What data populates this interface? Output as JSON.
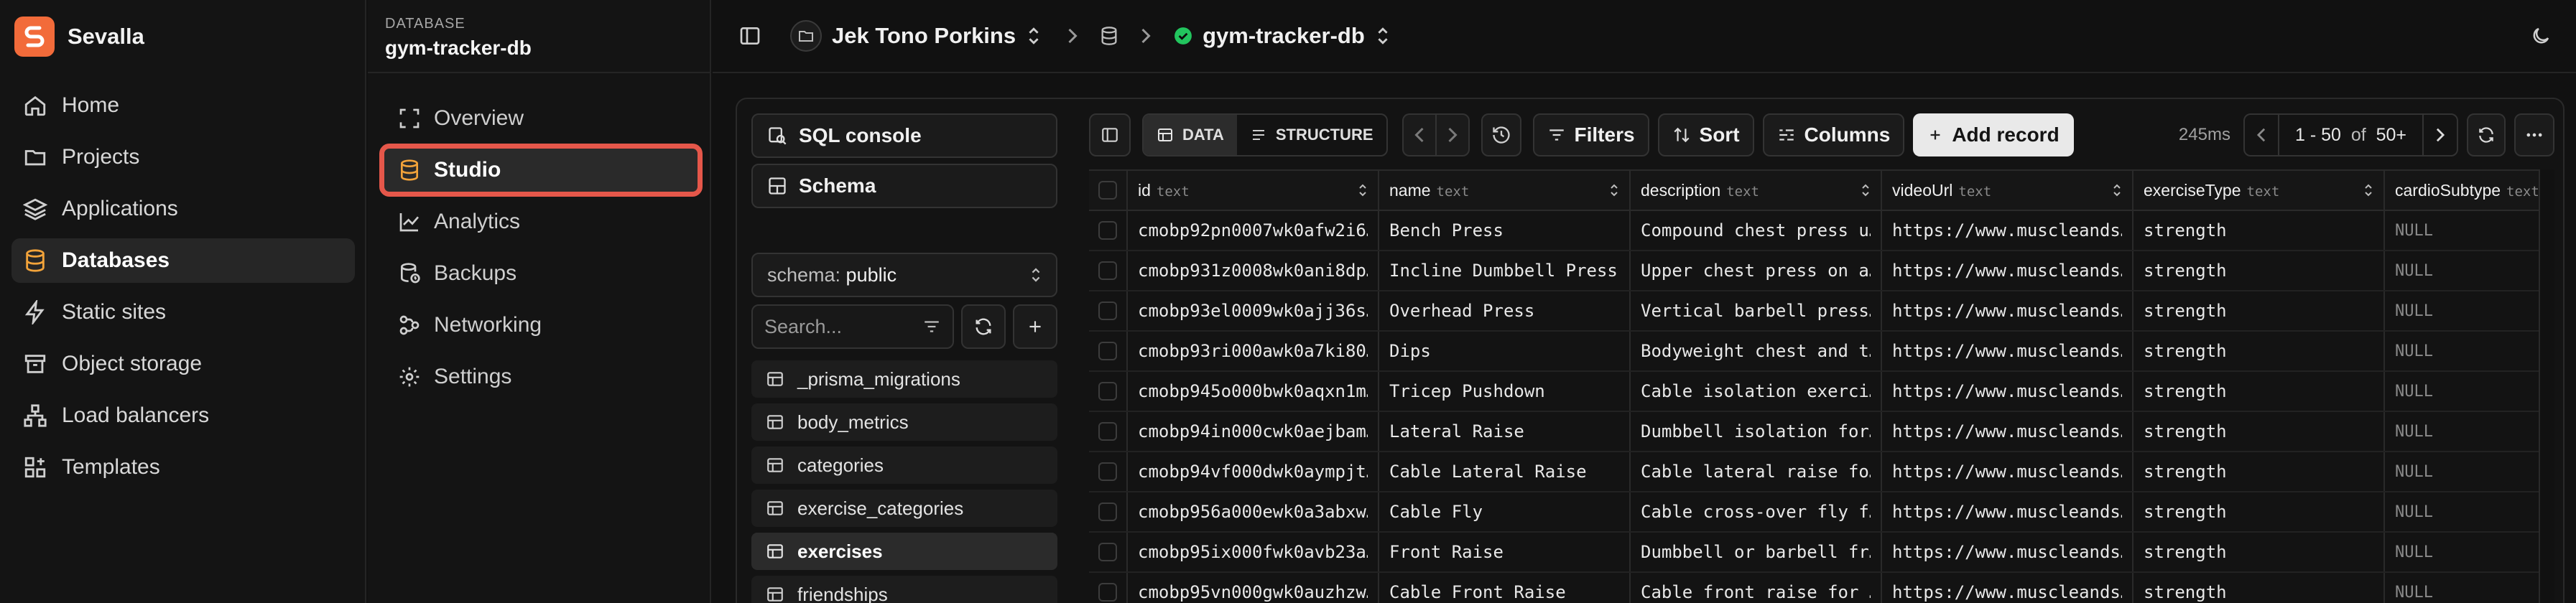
{
  "brand": {
    "name": "Sevalla"
  },
  "sidebar": {
    "items": [
      {
        "label": "Home",
        "icon": "home-icon"
      },
      {
        "label": "Projects",
        "icon": "folder-icon"
      },
      {
        "label": "Applications",
        "icon": "layers-icon"
      },
      {
        "label": "Databases",
        "icon": "database-icon",
        "active": true
      },
      {
        "label": "Static sites",
        "icon": "bolt-icon"
      },
      {
        "label": "Object storage",
        "icon": "archive-icon"
      },
      {
        "label": "Load balancers",
        "icon": "network-icon"
      },
      {
        "label": "Templates",
        "icon": "templates-icon"
      }
    ]
  },
  "db_sidebar": {
    "label": "DATABASE",
    "name": "gym-tracker-db",
    "items": [
      {
        "label": "Overview",
        "icon": "scan-icon"
      },
      {
        "label": "Studio",
        "icon": "database-icon",
        "active": true
      },
      {
        "label": "Analytics",
        "icon": "chart-icon"
      },
      {
        "label": "Backups",
        "icon": "backup-icon"
      },
      {
        "label": "Networking",
        "icon": "networking-icon"
      },
      {
        "label": "Settings",
        "icon": "gear-icon"
      }
    ]
  },
  "topbar": {
    "project": "Jek Tono Porkins",
    "database": "gym-tracker-db",
    "status_color": "#22c55e"
  },
  "studio": {
    "sql_console": "SQL console",
    "schema_btn": "Schema",
    "schema_select_prefix": "schema: ",
    "schema_select_value": "public",
    "search_placeholder": "Search...",
    "tables": [
      "_prisma_migrations",
      "body_metrics",
      "categories",
      "exercise_categories",
      "exercises",
      "friendships"
    ],
    "active_table": "exercises"
  },
  "toolbar": {
    "data_tab": "DATA",
    "structure_tab": "STRUCTURE",
    "filters": "Filters",
    "sort": "Sort",
    "columns": "Columns",
    "add_record": "Add record",
    "timing": "245ms",
    "page_range": "1 - 50",
    "page_of": "of",
    "page_total": "50+"
  },
  "table": {
    "columns": [
      {
        "name": "id",
        "type": "text"
      },
      {
        "name": "name",
        "type": "text"
      },
      {
        "name": "description",
        "type": "text"
      },
      {
        "name": "videoUrl",
        "type": "text"
      },
      {
        "name": "exerciseType",
        "type": "text"
      },
      {
        "name": "cardioSubtype",
        "type": "text"
      }
    ],
    "rows": [
      [
        "cmobp92pn0007wk0afw2i6…",
        "Bench Press",
        "Compound chest press u…",
        "https://www.muscleands…",
        "strength",
        "NULL"
      ],
      [
        "cmobp931z0008wk0ani8dp…",
        "Incline Dumbbell Press",
        "Upper chest press on a…",
        "https://www.muscleands…",
        "strength",
        "NULL"
      ],
      [
        "cmobp93el0009wk0ajj36s…",
        "Overhead Press",
        "Vertical barbell press…",
        "https://www.muscleands…",
        "strength",
        "NULL"
      ],
      [
        "cmobp93ri000awk0a7ki80…",
        "Dips",
        "Bodyweight chest and t…",
        "https://www.muscleands…",
        "strength",
        "NULL"
      ],
      [
        "cmobp945o000bwk0aqxn1m…",
        "Tricep Pushdown",
        "Cable isolation exerci…",
        "https://www.muscleands…",
        "strength",
        "NULL"
      ],
      [
        "cmobp94in000cwk0aejbam…",
        "Lateral Raise",
        "Dumbbell isolation for…",
        "https://www.muscleands…",
        "strength",
        "NULL"
      ],
      [
        "cmobp94vf000dwk0aympjt…",
        "Cable Lateral Raise",
        "Cable lateral raise fo…",
        "https://www.muscleands…",
        "strength",
        "NULL"
      ],
      [
        "cmobp956a000ewk0a3abxw…",
        "Cable Fly",
        "Cable cross-over fly f…",
        "https://www.muscleands…",
        "strength",
        "NULL"
      ],
      [
        "cmobp95ix000fwk0avb23a…",
        "Front Raise",
        "Dumbbell or barbell fr…",
        "https://www.muscleands…",
        "strength",
        "NULL"
      ],
      [
        "cmobp95vn000gwk0auzhzw…",
        "Cable Front Raise",
        "Cable front raise for …",
        "https://www.muscleands…",
        "strength",
        "NULL"
      ]
    ]
  }
}
